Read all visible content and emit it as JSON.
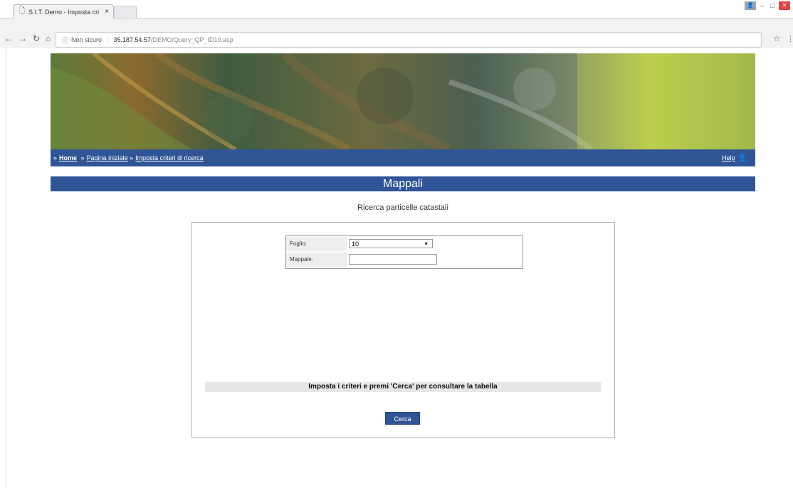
{
  "browser": {
    "tab_title": "S.I.T. Demo - Imposta cri",
    "tab_close": "×",
    "url_security": "Non sicuro",
    "url_host": "35.187.54.57",
    "url_path": "/DEMO/Query_QP_ID10.asp"
  },
  "header": {
    "breadcrumb": {
      "home": "Home",
      "items": [
        "Pagina iniziale",
        "Imposta criteri di ricerca"
      ]
    },
    "help_label": "Help"
  },
  "page": {
    "title": "Mappali",
    "subtitle": "Ricerca particelle catastali"
  },
  "form": {
    "foglio_label": "Foglio:",
    "foglio_value": "10",
    "mappale_label": "Mappale:",
    "mappale_value": "",
    "message": "Imposta i criteri e premi 'Cerca' per consultare la tabella",
    "cerca_label": "Cerca"
  }
}
